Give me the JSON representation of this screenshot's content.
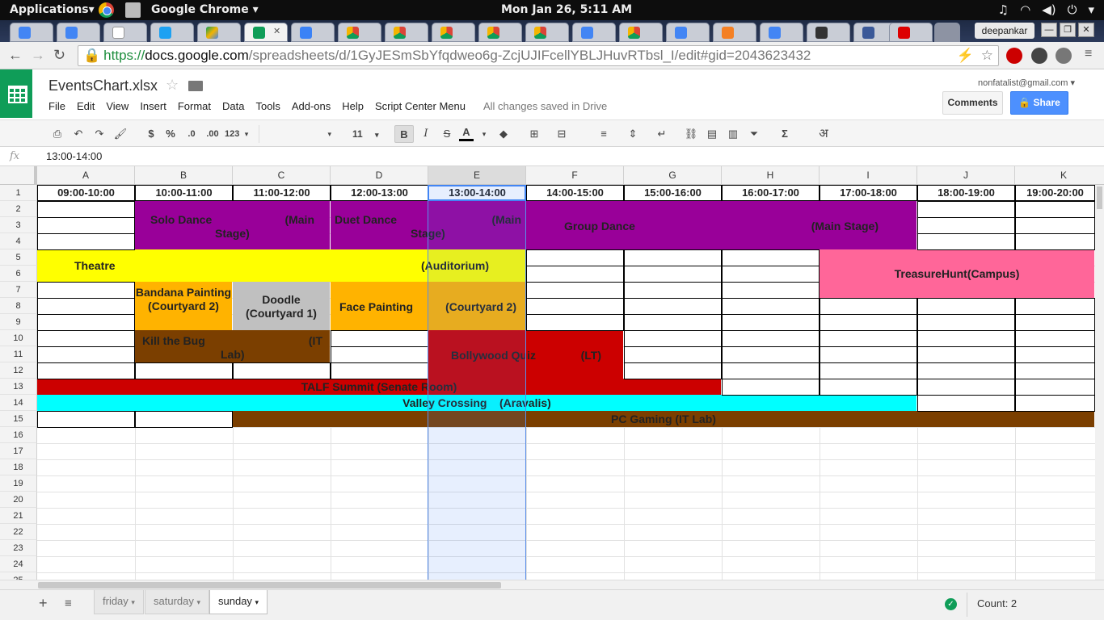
{
  "system": {
    "apps_menu": "Applications▾",
    "app_name": "Google Chrome ▾",
    "clock": "Mon Jan 26,  5:11 AM"
  },
  "chrome": {
    "user_button": "deepankar",
    "url_scheme": "https://",
    "url_domain": "docs.google.com",
    "url_path": "/spreadsheets/d/1GyJESmSbYfqdweo6g-ZcjUJIFcellYBLJHuvRTbsl_I/edit#gid=2043623432"
  },
  "doc": {
    "title": "EventsChart.xlsx",
    "user_email": "nonfatalist@gmail.com",
    "comments_label": "Comments",
    "share_label": "Share",
    "menu": [
      "File",
      "Edit",
      "View",
      "Insert",
      "Format",
      "Data",
      "Tools",
      "Add-ons",
      "Help",
      "Script Center Menu"
    ],
    "save_status": "All changes saved in Drive"
  },
  "format_toolbar": {
    "currency": "$",
    "percent": "%",
    "dec_decrease": ".0",
    "dec_increase": ".00",
    "more_formats": "123",
    "font_size": "11",
    "bold": "B",
    "italic": "I",
    "strike": "S",
    "text_color": "A",
    "sigma": "Σ",
    "input_tools": "अ"
  },
  "formula_bar": {
    "fx_label": "fx",
    "value": "13:00-14:00"
  },
  "columns": [
    "A",
    "B",
    "C",
    "D",
    "E",
    "F",
    "G",
    "H",
    "I",
    "J",
    "K"
  ],
  "rows": [
    "1",
    "2",
    "3",
    "4",
    "5",
    "6",
    "7",
    "8",
    "9",
    "10",
    "11",
    "12",
    "13",
    "14",
    "15",
    "16",
    "17",
    "18",
    "19",
    "20",
    "21",
    "22",
    "23",
    "24",
    "25"
  ],
  "time_slots": [
    "09:00-10:00",
    "10:00-11:00",
    "11:00-12:00",
    "12:00-13:00",
    "13:00-14:00",
    "14:00-15:00",
    "15:00-16:00",
    "16:00-17:00",
    "17:00-18:00",
    "18:00-19:00",
    "19:00-20:00"
  ],
  "events": {
    "solo_dance_name": "Solo Dance",
    "solo_dance_venue1": "(Main",
    "solo_dance_venue2": "Stage)",
    "duet_dance_name": "Duet Dance",
    "duet_dance_venue1": "(Main",
    "duet_dance_venue2": "Stage)",
    "group_dance_name": "Group Dance",
    "group_dance_venue": "(Main Stage)",
    "theatre_name": "Theatre",
    "theatre_venue": "(Auditorium)",
    "treasure_hunt": "TreasureHunt(Campus)",
    "bandana": "Bandana Painting (Courtyard 2)",
    "doodle": "Doodle (Courtyard 1)",
    "face_painting_name": "Face Painting",
    "face_painting_venue": "(Courtyard 2)",
    "kill_bug_name": "Kill the Bug",
    "kill_bug_venue1": "(IT",
    "kill_bug_venue2": "Lab)",
    "bollywood_name": "Bollywood Quiz",
    "bollywood_venue": "(LT)",
    "talf": "TALF Summit (Senate Room)",
    "valley": "Valley Crossing    (Aravalis)",
    "pc_gaming": "PC Gaming (IT Lab)"
  },
  "colors": {
    "purple": "#990099",
    "yellow": "#ffff00",
    "pink": "#ff6699",
    "orange": "#ffb300",
    "grey": "#c0c0c0",
    "brown": "#7b3f00",
    "red": "#cc0000",
    "cyan": "#00ffff",
    "selection": "#4285f4"
  },
  "sheets": [
    "friday",
    "saturday",
    "sunday"
  ],
  "active_sheet": "sunday",
  "status": {
    "count": "Count: 2"
  }
}
